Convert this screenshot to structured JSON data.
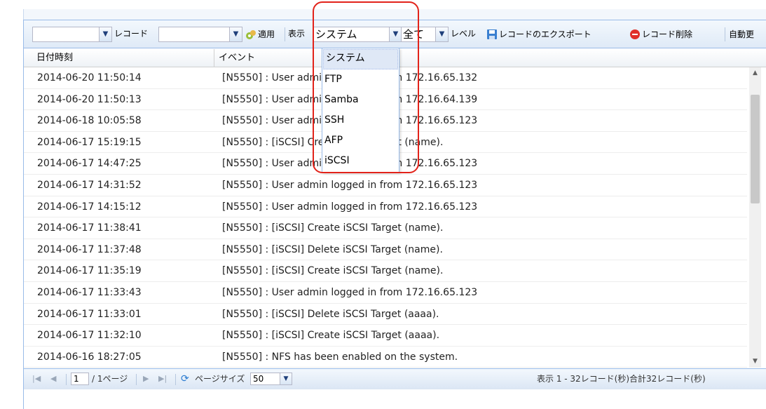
{
  "toolbar": {
    "combo1_value": "",
    "record_label": "レコード",
    "combo2_value": "",
    "apply_label": "適用",
    "display_label": "表示",
    "category_value": "システム",
    "level_value": "全て",
    "level_label": "レベル",
    "export_label": "レコードのエクスポート",
    "delete_label": "レコード削除",
    "auto_label": "自動更"
  },
  "grid": {
    "columns": [
      "日付時刻",
      "イベント"
    ],
    "rows": [
      [
        "2014-06-20 11:50:14",
        "[N5550] : User admin logged in from 172.16.65.132"
      ],
      [
        "2014-06-20 11:50:13",
        "[N5550] : User admin logged in from 172.16.64.139"
      ],
      [
        "2014-06-18 10:05:58",
        "[N5550] : User admin logged in from 172.16.65.123"
      ],
      [
        "2014-06-17 15:19:15",
        "[N5550] : [iSCSI] Create iSCSI Target (name)."
      ],
      [
        "2014-06-17 14:47:25",
        "[N5550] : User admin logged in from 172.16.65.123"
      ],
      [
        "2014-06-17 14:31:52",
        "[N5550] : User admin logged in from 172.16.65.123"
      ],
      [
        "2014-06-17 14:15:12",
        "[N5550] : User admin logged in from 172.16.65.123"
      ],
      [
        "2014-06-17 11:38:41",
        "[N5550] : [iSCSI] Create iSCSI Target (name)."
      ],
      [
        "2014-06-17 11:37:48",
        "[N5550] : [iSCSI] Delete iSCSI Target (name)."
      ],
      [
        "2014-06-17 11:35:19",
        "[N5550] : [iSCSI] Create iSCSI Target (name)."
      ],
      [
        "2014-06-17 11:33:43",
        "[N5550] : User admin logged in from 172.16.65.123"
      ],
      [
        "2014-06-17 11:33:01",
        "[N5550] : [iSCSI] Delete iSCSI Target (aaaa)."
      ],
      [
        "2014-06-17 11:32:10",
        "[N5550] : [iSCSI] Create iSCSI Target (aaaa)."
      ],
      [
        "2014-06-16 18:27:05",
        "[N5550] : NFS has been enabled on the system."
      ]
    ]
  },
  "dropdown": {
    "options": [
      "システム",
      "FTP",
      "Samba",
      "SSH",
      "AFP",
      "iSCSI"
    ],
    "selected_index": 0
  },
  "pager": {
    "page_value": "1",
    "page_of": "/ 1ページ",
    "page_size_label": "ページサイズ",
    "page_size_value": "50",
    "summary": "表示 1 - 32レコード(秒)合計32レコード(秒)"
  },
  "colors": {
    "accent_border": "#99bbe8",
    "highlight": "#e2231a",
    "delete_icon": "#e0302a",
    "export_icon": "#3a7fd0"
  }
}
